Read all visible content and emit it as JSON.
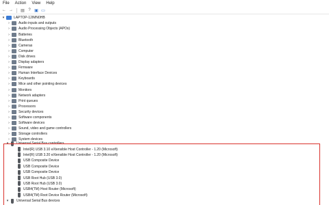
{
  "menu": [
    "File",
    "Action",
    "View",
    "Help"
  ],
  "toolbar": {
    "back_icon": "←",
    "forward_icon": "→",
    "properties_icon": "▤",
    "help_icon": "?",
    "update_icon": "▣",
    "monitor_icon": "▭"
  },
  "tree": {
    "root": "LAPTOP-12IMN0HB",
    "categories": [
      "Audio inputs and outputs",
      "Audio Processing Objects (APOs)",
      "Batteries",
      "Bluetooth",
      "Cameras",
      "Computer",
      "Disk drives",
      "Display adapters",
      "Firmware",
      "Human Interface Devices",
      "Keyboards",
      "Mice and other pointing devices",
      "Monitors",
      "Network adapters",
      "Print queues",
      "Processors",
      "Security devices",
      "Software components",
      "Software devices",
      "Sound, video and game controllers",
      "Storage controllers",
      "System devices"
    ],
    "usb_controllers": {
      "label": "Universal Serial Bus controllers",
      "children": [
        "Intel(R) USB 3.10 eXtensible Host Controller - 1.20 (Microsoft)",
        "Intel(R) USB 3.20 eXtensible Host Controller - 1.20 (Microsoft)",
        "USB Composite Device",
        "USB Composite Device",
        "USB Composite Device",
        "USB Root Hub (USB 3.0)",
        "USB Root Hub (USB 3.0)",
        "USB4(TM) Host Router (Microsoft)",
        "USB4(TM) Root Device Router (Microsoft)"
      ]
    },
    "usb_devices": {
      "label": "Universal Serial Bus devices"
    }
  },
  "colors": {
    "highlight_border": "#d9302b"
  }
}
